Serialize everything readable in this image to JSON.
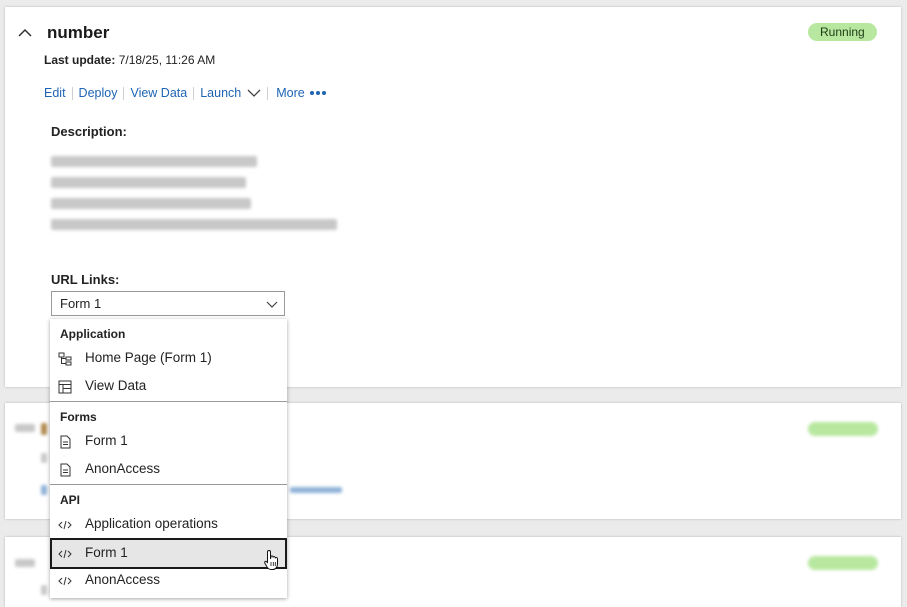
{
  "card": {
    "title": "number",
    "last_update_label": "Last update:",
    "last_update_value": "7/18/25, 11:26 AM",
    "status": "Running",
    "status_color": "#b8e8a0",
    "actions": {
      "edit": "Edit",
      "deploy": "Deploy",
      "view_data": "View Data",
      "launch": "Launch",
      "more": "More"
    },
    "description_label": "Description:",
    "url_links_label": "URL Links:",
    "url_select_value": "Form 1"
  },
  "dropdown": {
    "groups": [
      {
        "title": "Application",
        "items": [
          {
            "label": "Home Page (Form 1)",
            "icon": "sitemap-icon"
          },
          {
            "label": "View Data",
            "icon": "table-icon"
          }
        ]
      },
      {
        "title": "Forms",
        "items": [
          {
            "label": "Form 1",
            "icon": "document-icon"
          },
          {
            "label": "AnonAccess",
            "icon": "document-icon"
          }
        ]
      },
      {
        "title": "API",
        "items": [
          {
            "label": "Application operations",
            "icon": "code-icon"
          },
          {
            "label": "Form 1",
            "icon": "code-icon",
            "selected": true
          },
          {
            "label": "AnonAccess",
            "icon": "code-icon"
          }
        ]
      }
    ]
  },
  "colors": {
    "link": "#1e64b4",
    "selected_bg": "#e6e6e6"
  }
}
